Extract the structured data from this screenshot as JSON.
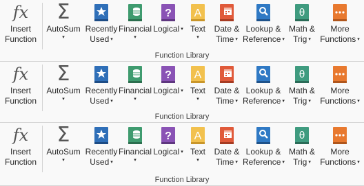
{
  "group_label": "Function Library",
  "buttons": {
    "insert_function": {
      "line1": "Insert",
      "line2": "Function"
    },
    "autosum": {
      "line1": "AutoSum",
      "caret": "▾"
    },
    "recently_used": {
      "line1": "Recently",
      "line2": "Used",
      "caret": "▾"
    },
    "financial": {
      "line1": "Financial",
      "caret": "▾"
    },
    "logical": {
      "line1": "Logical",
      "caret": "▾"
    },
    "text": {
      "line1": "Text",
      "caret": "▾"
    },
    "date_time": {
      "line1": "Date &",
      "line2": "Time",
      "caret": "▾"
    },
    "lookup_reference": {
      "line1": "Lookup &",
      "line2": "Reference",
      "caret": "▾"
    },
    "math_trig": {
      "line1": "Math &",
      "line2": "Trig",
      "caret": "▾"
    },
    "more_functions": {
      "line1": "More",
      "line2": "Functions",
      "caret": "▾"
    }
  },
  "icons": {
    "insert_function": "fx",
    "autosum": "Σ",
    "recently_used": "★",
    "financial": "coins",
    "logical": "?",
    "text": "A",
    "date_time": "calendar",
    "lookup_reference": "magnifier",
    "math_trig": "θ",
    "more_functions": "…"
  },
  "colors": {
    "recently_used": "#2f6fb8",
    "financial": "#3f9b6f",
    "logical": "#8a53b5",
    "text": "#f2c14e",
    "date_time": "#e05a3a",
    "lookup_reference": "#2f79c4",
    "math_trig": "#3f9b7f",
    "more_functions": "#e8792f"
  }
}
